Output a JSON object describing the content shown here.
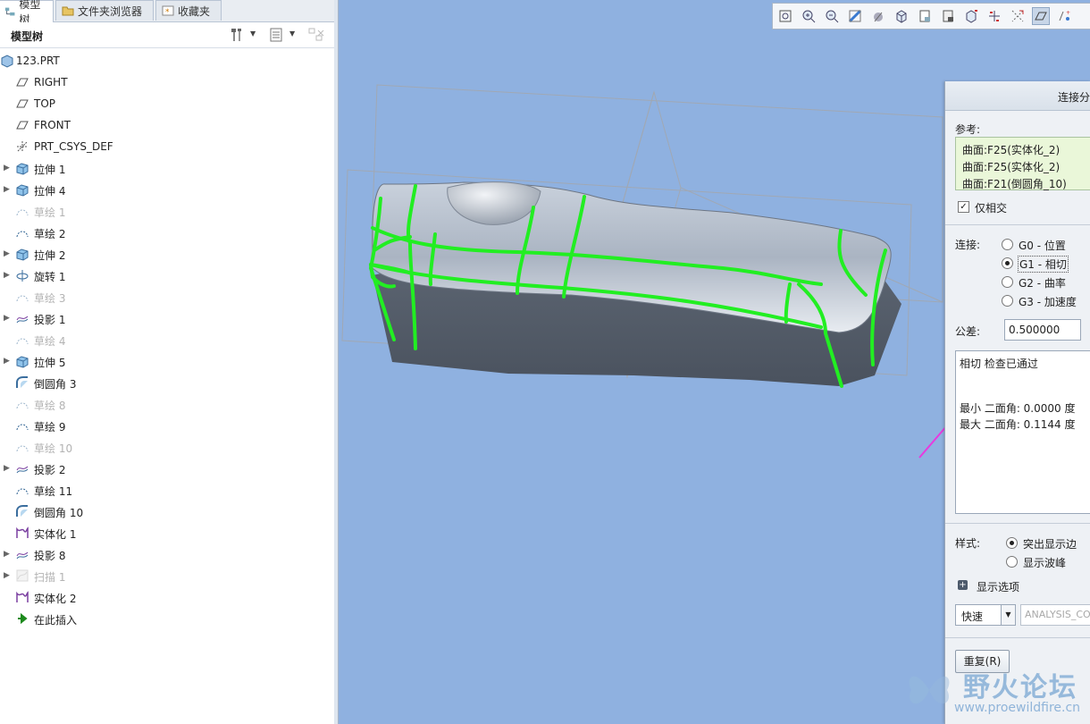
{
  "tabs": [
    {
      "label": "模型树"
    },
    {
      "label": "文件夹浏览器"
    },
    {
      "label": "收藏夹"
    }
  ],
  "tree_panel": {
    "title": "模型树"
  },
  "tree": [
    {
      "label": "123.PRT",
      "icon": "part-icon",
      "expandable": false,
      "dim": false
    },
    {
      "label": "RIGHT",
      "icon": "datum-plane-icon",
      "expandable": false,
      "dim": false
    },
    {
      "label": "TOP",
      "icon": "datum-plane-icon",
      "expandable": false,
      "dim": false
    },
    {
      "label": "FRONT",
      "icon": "datum-plane-icon",
      "expandable": false,
      "dim": false
    },
    {
      "label": "PRT_CSYS_DEF",
      "icon": "csys-icon",
      "expandable": false,
      "dim": false
    },
    {
      "label": "拉伸 1",
      "icon": "extrude-icon",
      "expandable": true,
      "dim": false
    },
    {
      "label": "拉伸 4",
      "icon": "extrude-icon",
      "expandable": true,
      "dim": false
    },
    {
      "label": "草绘 1",
      "icon": "sketch-icon",
      "expandable": false,
      "dim": true
    },
    {
      "label": "草绘 2",
      "icon": "sketch-icon",
      "expandable": false,
      "dim": false
    },
    {
      "label": "拉伸 2",
      "icon": "extrude-icon",
      "expandable": true,
      "dim": false
    },
    {
      "label": "旋转 1",
      "icon": "revolve-icon",
      "expandable": true,
      "dim": false
    },
    {
      "label": "草绘 3",
      "icon": "sketch-icon",
      "expandable": false,
      "dim": true
    },
    {
      "label": "投影 1",
      "icon": "project-icon",
      "expandable": true,
      "dim": false
    },
    {
      "label": "草绘 4",
      "icon": "sketch-icon",
      "expandable": false,
      "dim": true
    },
    {
      "label": "拉伸 5",
      "icon": "extrude-icon",
      "expandable": true,
      "dim": false
    },
    {
      "label": "倒圆角 3",
      "icon": "round-icon",
      "expandable": false,
      "dim": false
    },
    {
      "label": "草绘 8",
      "icon": "sketch-icon",
      "expandable": false,
      "dim": true
    },
    {
      "label": "草绘 9",
      "icon": "sketch-icon",
      "expandable": false,
      "dim": false
    },
    {
      "label": "草绘 10",
      "icon": "sketch-icon",
      "expandable": false,
      "dim": true
    },
    {
      "label": "投影 2",
      "icon": "project-icon",
      "expandable": true,
      "dim": false
    },
    {
      "label": "草绘 11",
      "icon": "sketch-icon",
      "expandable": false,
      "dim": false
    },
    {
      "label": "倒圆角 10",
      "icon": "round-icon",
      "expandable": false,
      "dim": false
    },
    {
      "label": "实体化 1",
      "icon": "solidify-icon",
      "expandable": false,
      "dim": false
    },
    {
      "label": "投影 8",
      "icon": "project-icon",
      "expandable": true,
      "dim": false
    },
    {
      "label": "扫描 1",
      "icon": "sweep-icon",
      "expandable": true,
      "dim": true
    },
    {
      "label": "实体化 2",
      "icon": "solidify-icon",
      "expandable": false,
      "dim": false
    },
    {
      "label": "在此插入",
      "icon": "insert-arrow-icon",
      "expandable": false,
      "dim": false
    }
  ],
  "dialog": {
    "title": "连接分",
    "references_label": "参考:",
    "references": [
      "曲面:F25(实体化_2)",
      "曲面:F25(实体化_2)",
      "曲面:F21(倒圆角_10)"
    ],
    "intersect_only": {
      "label": "仅相交",
      "checked": true
    },
    "connection_label": "连接:",
    "connection_options": [
      {
        "label": "G0 - 位置",
        "selected": false
      },
      {
        "label": "G1 - 相切",
        "selected": true
      },
      {
        "label": "G2 - 曲率",
        "selected": false
      },
      {
        "label": "G3 - 加速度",
        "selected": false
      }
    ],
    "tolerance_label": "公差:",
    "tolerance_value": "0.500000",
    "result_lines": [
      "相切 检查已通过",
      "最小 二面角: 0.0000 度",
      "最大 二面角: 0.1144 度"
    ],
    "style_label": "样式:",
    "style_options": [
      {
        "label": "突出显示边",
        "selected": true
      },
      {
        "label": "显示波峰",
        "selected": false
      }
    ],
    "display_options_label": "显示选项",
    "mode_value": "快速",
    "analysis_name": "ANALYSIS_CO",
    "repeat_button": "重复(R)"
  },
  "watermark": {
    "title": "野火论坛",
    "url": "www.proewildfire.cn"
  },
  "colors": {
    "viewport_bg": "#8fb1e0",
    "highlight_green": "#22ee22",
    "arrow_magenta": "#e83adf",
    "reference_bg": "#eaf7d9"
  }
}
